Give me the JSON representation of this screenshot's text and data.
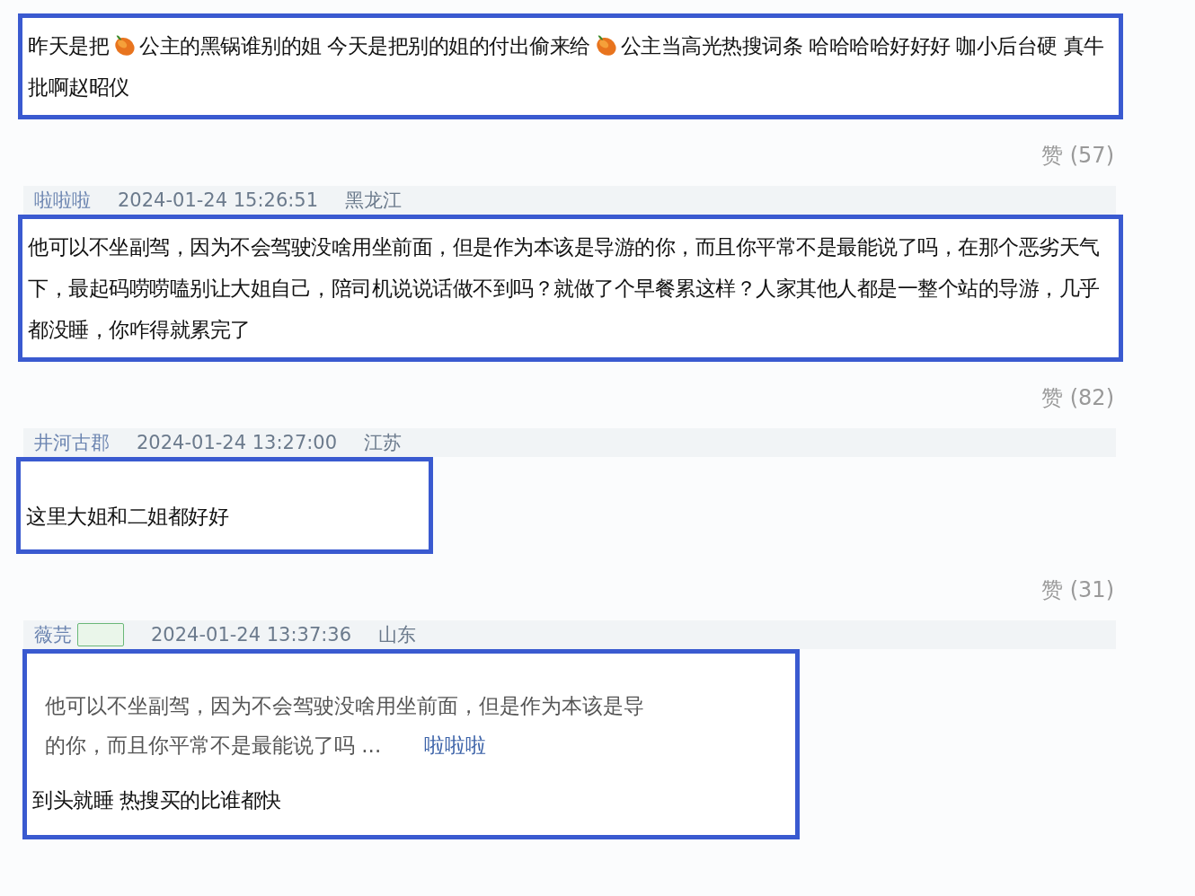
{
  "items": [
    {
      "kind": "body",
      "parts": [
        {
          "kind": "text",
          "text": "昨天是把"
        },
        {
          "kind": "emoji"
        },
        {
          "kind": "text",
          "text": "公主的黑锅谁别的姐 今天是把别的姐的付出偷来给"
        },
        {
          "kind": "emoji"
        },
        {
          "kind": "text",
          "text": "公主当高光热搜词条 哈哈哈哈好好好 咖小后台硬 真牛批啊赵昭仪"
        }
      ]
    },
    {
      "kind": "likes",
      "text": "赞 (57)"
    },
    {
      "kind": "header",
      "user": "啦啦啦",
      "time": "2024-01-24 15:26:51",
      "place": "黑龙江"
    },
    {
      "kind": "body",
      "parts": [
        {
          "kind": "text",
          "text": "他可以不坐副驾，因为不会驾驶没啥用坐前面，但是作为本该是导游的你，而且你平常不是最能说了吗，在那个恶劣天气下，最起码唠唠嗑别让大姐自己，陪司机说说话做不到吗？就做了个早餐累这样？人家其他人都是一整个站的导游，几乎都没睡，你咋得就累完了"
        }
      ]
    },
    {
      "kind": "likes",
      "text": "赞 (82)"
    },
    {
      "kind": "header",
      "user": "井河古郡",
      "time": "2024-01-24 13:27:00",
      "place": "江苏"
    },
    {
      "kind": "body",
      "parts": [
        {
          "kind": "text",
          "text": "这里大姐和二姐都好好"
        }
      ]
    },
    {
      "kind": "likes",
      "text": "赞 (31)"
    },
    {
      "kind": "header",
      "user": "薇芫",
      "tag": true,
      "time": "2024-01-24 13:37:36",
      "place": "山东"
    },
    {
      "kind": "reply",
      "quote": "他可以不坐副驾，因为不会驾驶没啥用坐前面，但是作为本该是导",
      "quote_end": "的你，而且你平常不是最能说了吗 ...",
      "quote_author": "啦啦啦",
      "parts": [
        {
          "kind": "text",
          "text": "到头就睡 热搜买的比谁都快"
        }
      ]
    }
  ]
}
